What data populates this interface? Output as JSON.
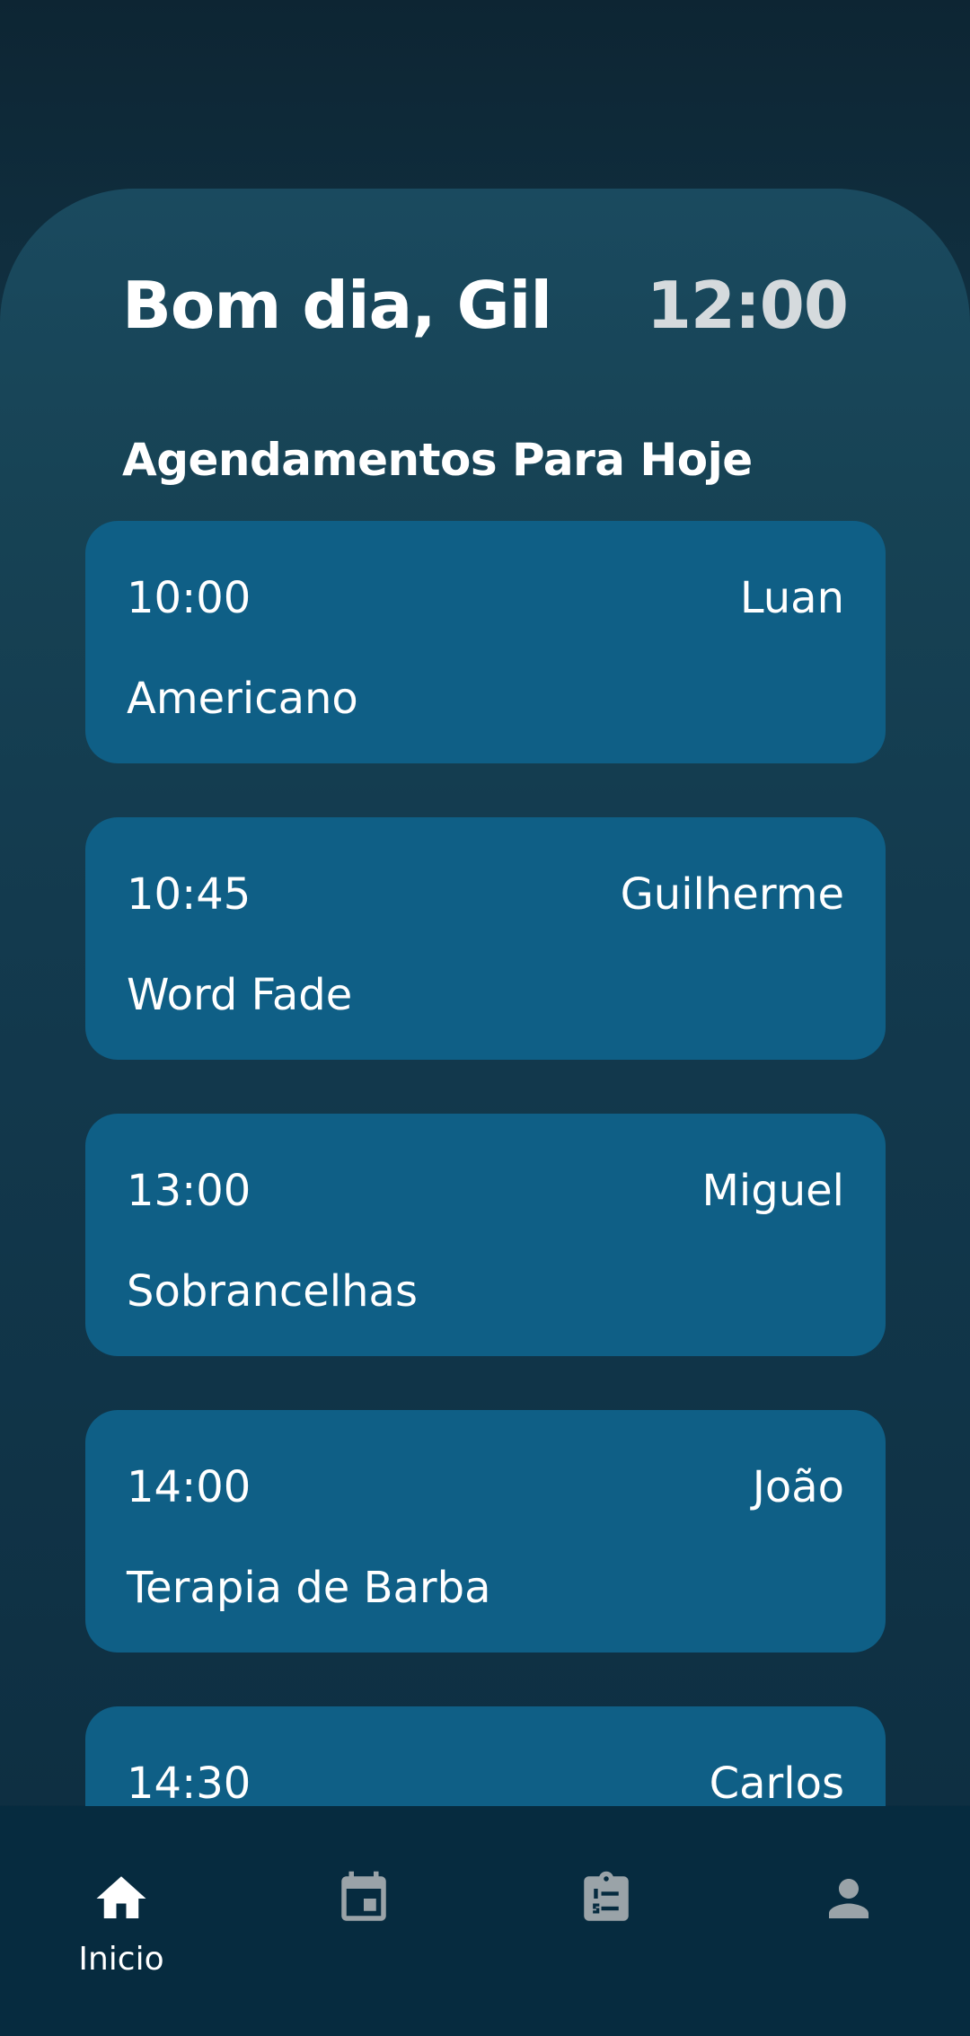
{
  "header": {
    "greeting": "Bom dia, Gil",
    "time": "12:00"
  },
  "section": {
    "title": "Agendamentos Para Hoje"
  },
  "appointments": [
    {
      "time": "10:00",
      "client": "Luan",
      "service": "Americano"
    },
    {
      "time": "10:45",
      "client": "Guilherme",
      "service": "Word Fade"
    },
    {
      "time": "13:00",
      "client": "Miguel",
      "service": "Sobrancelhas"
    },
    {
      "time": "14:00",
      "client": "João",
      "service": "Terapia de Barba"
    },
    {
      "time": "14:30",
      "client": "Carlos",
      "service": ""
    }
  ],
  "bottom_nav": {
    "items": [
      {
        "label": "Inicio",
        "icon": "home-icon",
        "active": true
      },
      {
        "label": "",
        "icon": "calendar-icon",
        "active": false
      },
      {
        "label": "",
        "icon": "clipboard-list-icon",
        "active": false
      },
      {
        "label": "",
        "icon": "person-icon",
        "active": false
      }
    ]
  },
  "colors": {
    "card_background": "#0f5f86",
    "active_icon": "#ffffff",
    "inactive_icon": "#9aa3a8",
    "nav_background": "#062b3f"
  }
}
